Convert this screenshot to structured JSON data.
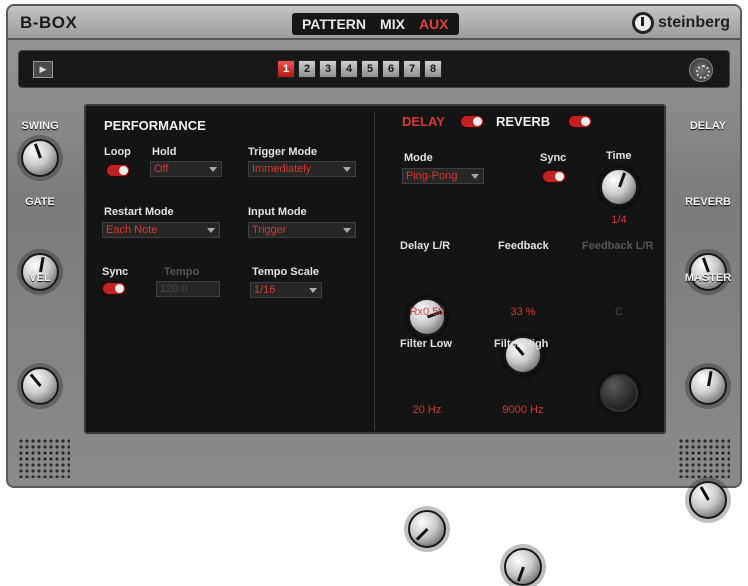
{
  "app": {
    "title": "B-BOX"
  },
  "tabs": [
    {
      "label": "PATTERN",
      "active": false
    },
    {
      "label": "MIX",
      "active": false
    },
    {
      "label": "AUX",
      "active": true
    }
  ],
  "logo": {
    "text": "steinberg"
  },
  "transport": {
    "play_icon": "▶"
  },
  "pads": [
    "1",
    "2",
    "3",
    "4",
    "5",
    "6",
    "7",
    "8"
  ],
  "left_knobs": [
    {
      "label": "SWING",
      "rotation_deg": -20
    },
    {
      "label": "GATE",
      "rotation_deg": 10
    },
    {
      "label": "VEL",
      "rotation_deg": -40
    }
  ],
  "right_knobs": [
    {
      "label": "DELAY",
      "rotation_deg": -20
    },
    {
      "label": "REVERB",
      "rotation_deg": 10
    },
    {
      "label": "MASTER",
      "rotation_deg": -30
    }
  ],
  "performance": {
    "title": "PERFORMANCE",
    "loop_label": "Loop",
    "hold_label": "Hold",
    "hold_value": "Off",
    "trigger_mode_label": "Trigger Mode",
    "trigger_mode_value": "Immediately",
    "restart_mode_label": "Restart Mode",
    "restart_mode_value": "Each Note",
    "input_mode_label": "Input Mode",
    "input_mode_value": "Trigger",
    "sync_label": "Sync",
    "tempo_label": "Tempo",
    "tempo_value": "120.0",
    "tempo_scale_label": "Tempo Scale",
    "tempo_scale_value": "1/16"
  },
  "fx": {
    "delay_tab": "DELAY",
    "reverb_tab": "REVERB",
    "mode_label": "Mode",
    "mode_value": "Ping-Pong",
    "sync_label": "Sync",
    "time_label": "Time",
    "time_value": "1/4",
    "delay_lr_label": "Delay L/R",
    "delay_lr_value": "Rx0.50",
    "feedback_label": "Feedback",
    "feedback_value": "33 %",
    "feedback_lr_label": "Feedback L/R",
    "feedback_lr_value": "C",
    "filter_low_label": "Filter Low",
    "filter_low_value": "20 Hz",
    "filter_high_label": "Filter High",
    "filter_high_value": "9000 Hz"
  },
  "colors": {
    "accent": "#d43838",
    "panel_bg": "#141414",
    "frame": "#8a8a8a"
  }
}
